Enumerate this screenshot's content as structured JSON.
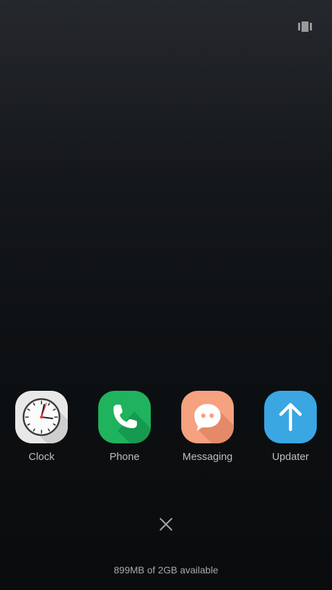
{
  "header": {
    "icon": "cards-view-icon"
  },
  "apps": [
    {
      "label": "Clock",
      "icon": "clock-icon",
      "color": "#eaeaea"
    },
    {
      "label": "Phone",
      "icon": "phone-icon",
      "color": "#1fb35e"
    },
    {
      "label": "Messaging",
      "icon": "chat-bubble-icon",
      "color": "#f6a180"
    },
    {
      "label": "Updater",
      "icon": "arrow-up-icon",
      "color": "#3aa6e2"
    }
  ],
  "close": {
    "icon": "close-icon"
  },
  "memory": {
    "text": "899MB of 2GB available"
  }
}
